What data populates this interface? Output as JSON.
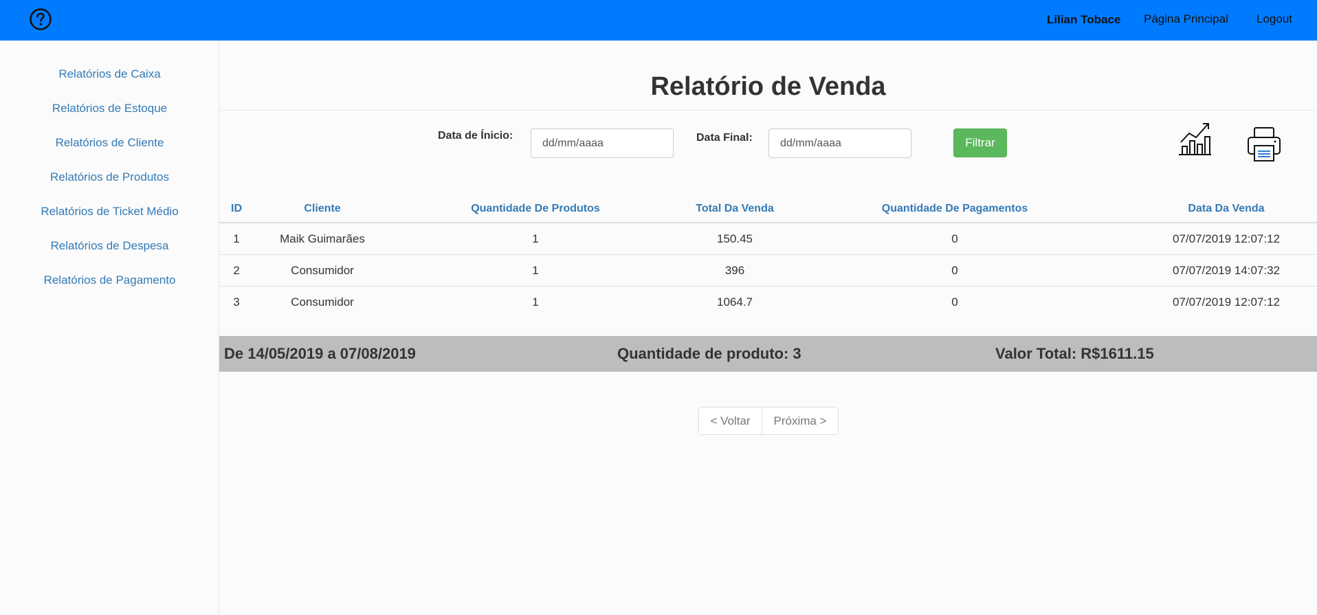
{
  "topbar": {
    "help_icon": "help-circle-icon",
    "user_name": "Lilian Tobace",
    "home_label": "Página Principal",
    "logout_label": "Logout",
    "color": "#007bff"
  },
  "sidebar": {
    "items": [
      {
        "label": "Relatórios de Caixa"
      },
      {
        "label": "Relatórios de Estoque"
      },
      {
        "label": "Relatórios de Cliente"
      },
      {
        "label": "Relatórios de Produtos"
      },
      {
        "label": "Relatórios de Ticket Médio"
      },
      {
        "label": "Relatórios de Despesa"
      },
      {
        "label": "Relatórios de Pagamento"
      }
    ]
  },
  "main": {
    "title": "Relatório de Venda",
    "filter": {
      "start_label": "Data de Ínicio:",
      "start_placeholder": "dd/mm/aaaa",
      "end_label": "Data Final:",
      "end_placeholder": "dd/mm/aaaa",
      "button_label": "Filtrar",
      "chart_icon": "chart-growth-icon",
      "print_icon": "printer-icon"
    },
    "table": {
      "headers": [
        "ID",
        "Cliente",
        "Quantidade De Produtos",
        "Total Da Venda",
        "Quantidade De Pagamentos",
        "Data Da Venda"
      ],
      "rows": [
        [
          "1",
          "Maik Guimarães",
          "1",
          "150.45",
          "0",
          "07/07/2019 12:07:12"
        ],
        [
          "2",
          "Consumidor",
          "1",
          "396",
          "0",
          "07/07/2019 14:07:32"
        ],
        [
          "3",
          "Consumidor",
          "1",
          "1064.7",
          "0",
          "07/07/2019 12:07:12"
        ]
      ]
    },
    "summary": {
      "period": "De 14/05/2019 a 07/08/2019",
      "quantity": "Quantidade de produto: 3",
      "total": "Valor Total: R$1611.15"
    },
    "pagination": {
      "prev_label": "< Voltar",
      "next_label": "Próxima >"
    }
  }
}
